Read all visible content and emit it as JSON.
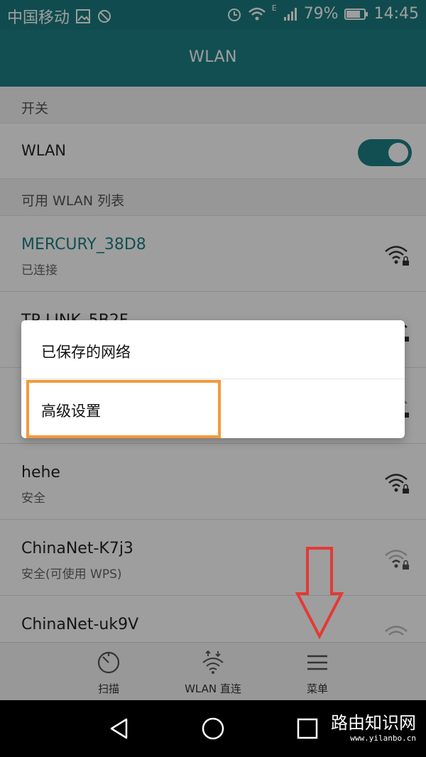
{
  "status_bar": {
    "carrier": "中国移动",
    "network_type": "E",
    "battery": "79%",
    "time": "14:45",
    "icons": [
      "image-icon",
      "no-disturb-icon",
      "alarm-icon",
      "wifi-icon",
      "signal-icon",
      "battery-icon"
    ]
  },
  "app_bar": {
    "title": "WLAN"
  },
  "sections": {
    "switch_header": "开关",
    "list_header": "可用 WLAN 列表"
  },
  "wlan_toggle": {
    "label": "WLAN",
    "state": "on"
  },
  "networks": [
    {
      "name": "MERCURY_38D8",
      "status": "已连接",
      "connected": true
    },
    {
      "name": "TP-LINK_5B2F",
      "status": "",
      "connected": false
    },
    {
      "name": "",
      "status": "",
      "connected": false
    },
    {
      "name": "hehe",
      "status": "安全",
      "connected": false
    },
    {
      "name": "ChinaNet-K7j3",
      "status": "安全(可使用 WPS)",
      "connected": false
    },
    {
      "name": "ChinaNet-uk9V",
      "status": "",
      "connected": false
    }
  ],
  "popup_menu": {
    "items": [
      "已保存的网络",
      "高级设置"
    ],
    "highlighted_index": 1
  },
  "bottom_bar": {
    "scan": "扫描",
    "wlan_direct": "WLAN 直连",
    "menu": "菜单"
  },
  "watermark": {
    "title": "路由知识网",
    "url": "www.yilanbo.cn"
  },
  "colors": {
    "accent": "#1d8085",
    "status_bar": "#1b7b80",
    "highlight": "#f39a3b",
    "arrow": "#e53935"
  }
}
